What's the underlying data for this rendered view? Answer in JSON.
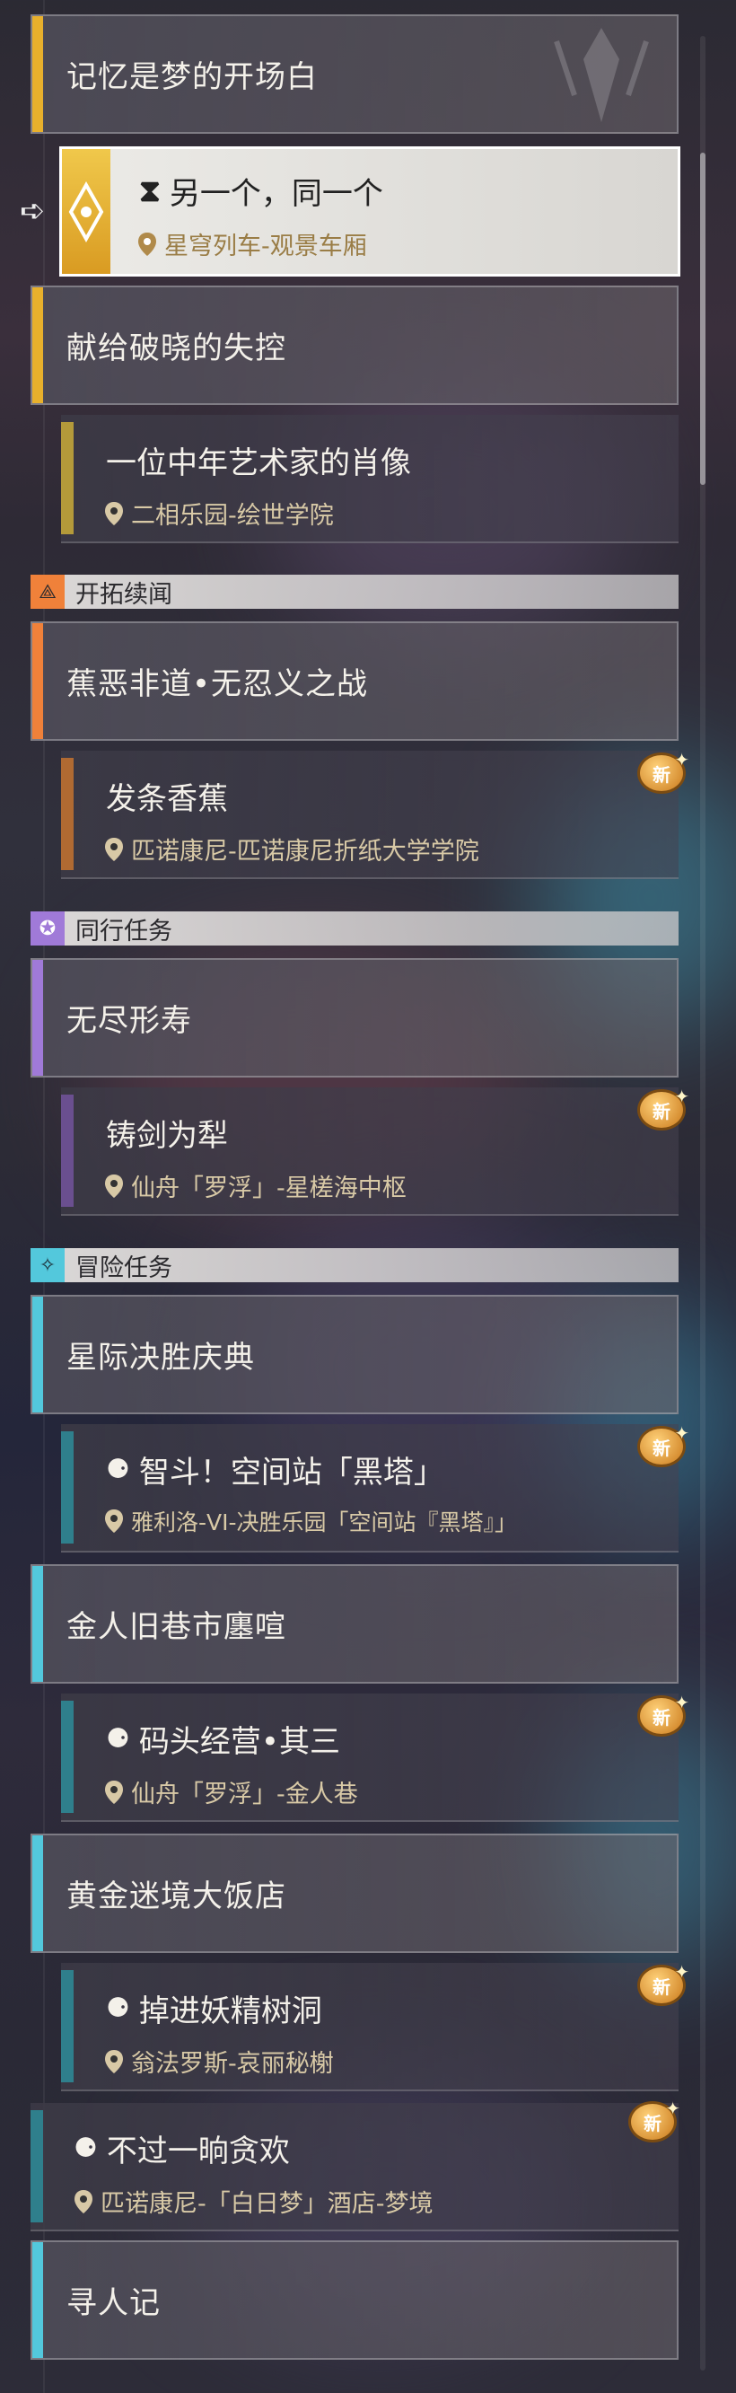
{
  "colors": {
    "gold": "#e8b02c",
    "orange": "#f0813a",
    "purple": "#a07ad8",
    "cyan": "#53c8dc",
    "brown": "#b06a32",
    "violet": "#6a4f8f",
    "teal": "#2f7f8c"
  },
  "headers": [
    {
      "title": "记忆是梦的开场白"
    },
    {
      "title": "献给破晓的失控"
    },
    {
      "title": "蕉恶非道•无忍义之战"
    },
    {
      "title": "无尽形寿"
    },
    {
      "title": "星际决胜庆典"
    },
    {
      "title": "金人旧巷市廛喧"
    },
    {
      "title": "黄金迷境大饭店"
    },
    {
      "title": "寻人记"
    }
  ],
  "sections": [
    {
      "label": "开拓续闻",
      "icon": "pathfinder-icon"
    },
    {
      "label": "同行任务",
      "icon": "star-icon"
    },
    {
      "label": "冒险任务",
      "icon": "diamond-sparkle-icon"
    }
  ],
  "quests": {
    "selected": {
      "title": "另一个，同一个",
      "location": "星穹列车-观景车厢",
      "icon": "hourglass-icon"
    },
    "q1": {
      "title": "一位中年艺术家的肖像",
      "location": "二相乐园-绘世学院"
    },
    "q2": {
      "title": "发条香蕉",
      "location": "匹诺康尼-匹诺康尼折纸大学学院"
    },
    "q3": {
      "title": "铸剑为犁",
      "location": "仙舟「罗浮」-星槎海中枢"
    },
    "q4": {
      "title": "智斗！空间站「黑塔」",
      "location": "雅利洛-VI-决胜乐园「空间站『黑塔』」"
    },
    "q5": {
      "title": "码头经营•其三",
      "location": "仙舟「罗浮」-金人巷"
    },
    "q6": {
      "title": "掉进妖精树洞",
      "location": "翁法罗斯-哀丽秘榭"
    },
    "q7": {
      "title": "不过一晌贪欢",
      "location": "匹诺康尼-「白日梦」酒店-梦境"
    }
  },
  "badge": {
    "label": "新"
  }
}
